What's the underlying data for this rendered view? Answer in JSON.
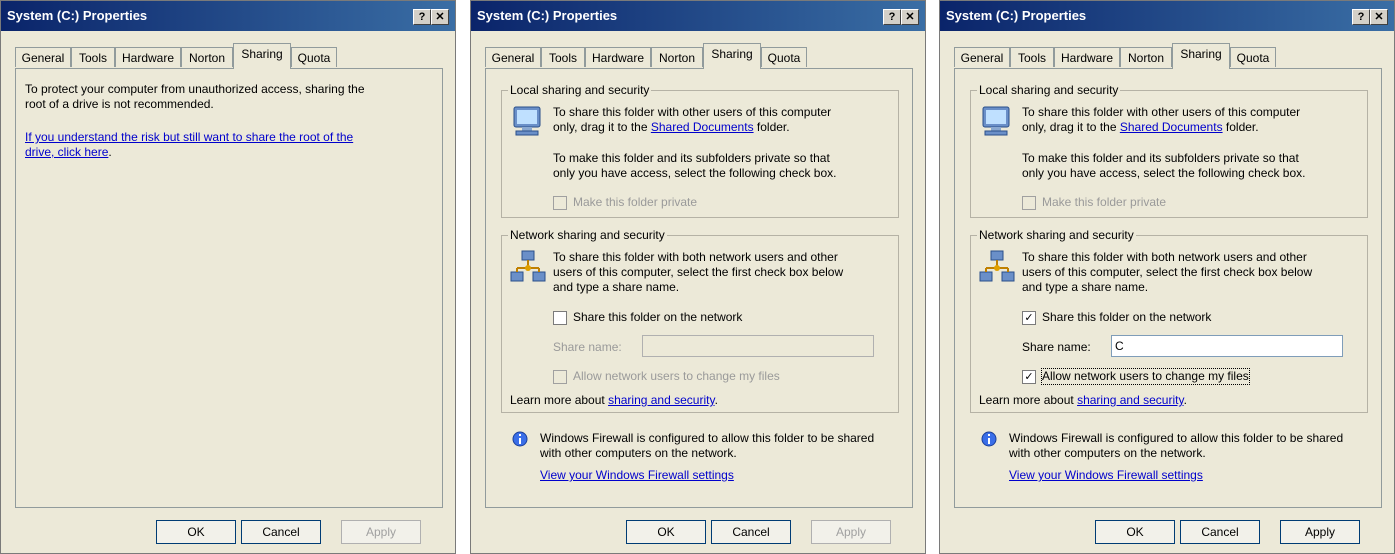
{
  "dialogs": [
    {
      "title": "System (C:) Properties",
      "tabs": [
        "General",
        "Tools",
        "Hardware",
        "Norton",
        "Sharing",
        "Quota"
      ],
      "active_tab": "Sharing",
      "warning_line1": "To protect your computer from unauthorized access, sharing the",
      "warning_line2": "root of a drive is not recommended.",
      "risk_link_line1": "If you understand the risk but still want to share the root of the",
      "risk_link_line2": "drive, click here",
      "risk_link_period": ".",
      "buttons": {
        "ok": "OK",
        "cancel": "Cancel",
        "apply": "Apply"
      },
      "apply_enabled": false
    },
    {
      "title": "System (C:) Properties",
      "tabs": [
        "General",
        "Tools",
        "Hardware",
        "Norton",
        "Sharing",
        "Quota"
      ],
      "active_tab": "Sharing",
      "local": {
        "label": "Local sharing and security",
        "line1": "To share this folder with other users of this computer",
        "line2_pre": "only, drag it to the ",
        "link": "Shared Documents",
        "line2_post": " folder.",
        "line3": "To make this folder and its subfolders private so that",
        "line4": "only you have access, select the following check box.",
        "private_label": "Make this folder private",
        "private_checked": false
      },
      "network": {
        "label": "Network sharing and security",
        "line1": "To share this folder with both network users and other",
        "line2": "users of this computer, select the first check box below",
        "line3": "and type a share name.",
        "share_label": "Share this folder on the network",
        "share_checked": false,
        "share_name_label": "Share name:",
        "share_name_value": "",
        "allow_label": "Allow network users to change my files",
        "allow_checked": false,
        "learn_pre": "Learn more about ",
        "learn_link": "sharing and security",
        "learn_post": "."
      },
      "firewall": {
        "line1": "Windows Firewall is configured to allow this folder to be shared",
        "line2": "with other computers on the network.",
        "link": "View your Windows Firewall settings"
      },
      "buttons": {
        "ok": "OK",
        "cancel": "Cancel",
        "apply": "Apply"
      },
      "apply_enabled": false
    },
    {
      "title": "System (C:) Properties",
      "tabs": [
        "General",
        "Tools",
        "Hardware",
        "Norton",
        "Sharing",
        "Quota"
      ],
      "active_tab": "Sharing",
      "local": {
        "label": "Local sharing and security",
        "line1": "To share this folder with other users of this computer",
        "line2_pre": "only, drag it to the ",
        "link": "Shared Documents",
        "line2_post": " folder.",
        "line3": "To make this folder and its subfolders private so that",
        "line4": "only you have access, select the following check box.",
        "private_label": "Make this folder private",
        "private_checked": false
      },
      "network": {
        "label": "Network sharing and security",
        "line1": "To share this folder with both network users and other",
        "line2": "users of this computer, select the first check box below",
        "line3": "and type a share name.",
        "share_label": "Share this folder on the network",
        "share_checked": true,
        "share_name_label": "Share name:",
        "share_name_value": "C",
        "allow_label": "Allow network users to change my files",
        "allow_checked": true,
        "learn_pre": "Learn more about ",
        "learn_link": "sharing and security",
        "learn_post": "."
      },
      "firewall": {
        "line1": "Windows Firewall is configured to allow this folder to be shared",
        "line2": "with other computers on the network.",
        "link": "View your Windows Firewall settings"
      },
      "buttons": {
        "ok": "OK",
        "cancel": "Cancel",
        "apply": "Apply"
      },
      "apply_enabled": true
    }
  ],
  "icons": {
    "help": "help-button-icon",
    "close": "close-icon",
    "computer": "computer-monitor-icon",
    "network": "network-computers-icon",
    "info": "info-icon",
    "checkmark": "checkmark-icon"
  },
  "glyphs": {
    "help": "?",
    "close": "✕",
    "check": "✓",
    "info": "i"
  },
  "colors": {
    "titlebar": "#0a246a",
    "link": "#0000cc",
    "dialog_bg": "#ece9d8"
  }
}
